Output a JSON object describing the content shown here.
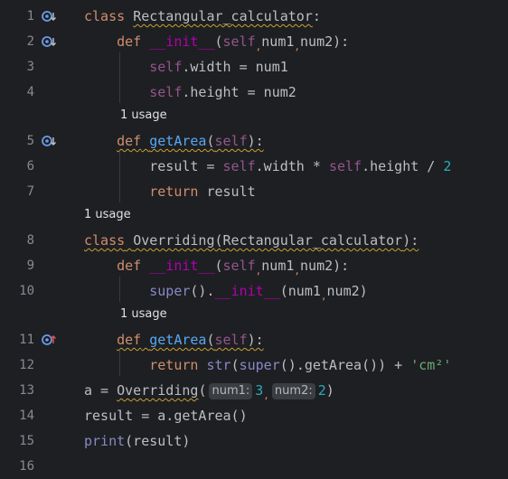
{
  "gutter": {
    "line_numbers": [
      "1",
      "2",
      "3",
      "4",
      "5",
      "6",
      "7",
      "8",
      "9",
      "10",
      "11",
      "12",
      "13",
      "14",
      "15",
      "16"
    ]
  },
  "usages": {
    "before_line5": "1 usage",
    "before_line8": "1 usage",
    "before_line11": "1 usage"
  },
  "code": {
    "l1_kw": "class",
    "l1_name": "Rectangular_calculator",
    "l1_colon": ":",
    "l2_kw": "def",
    "l2_name": "__init__",
    "l2_self": "self",
    "l2_p1": "num1",
    "l2_p2": "num2",
    "l3_self": "self",
    "l3_rest": ".width = num1",
    "l4_self": "self",
    "l4_rest": ".height = num2",
    "l5_kw": "def",
    "l5_name": "getArea",
    "l5_self": "self",
    "l6_var": "result",
    "l6_eq": " = ",
    "l6_self1": "self",
    "l6_mid": ".width * ",
    "l6_self2": "self",
    "l6_mid2": ".height / ",
    "l6_num": "2",
    "l7_kw": "return",
    "l7_rest": " result",
    "l8_kw": "class",
    "l8_name": "Overriding",
    "l8_base": "Rectangular_calculator",
    "l9_kw": "def",
    "l9_name": "__init__",
    "l9_self": "self",
    "l9_p1": "num1",
    "l9_p2": "num2",
    "l10_super": "super",
    "l10_init": "__init__",
    "l10_args": "num1",
    "l10_args2": "num2",
    "l11_kw": "def",
    "l11_name": "getArea",
    "l11_self": "self",
    "l12_kw": "return",
    "l12_str": "str",
    "l12_super": "super",
    "l12_call": ".getArea",
    "l12_plus": " + ",
    "l12_lit": "'cm²'",
    "l13_a": "a = ",
    "l13_cls": "Overriding",
    "l13_hint1": "num1:",
    "l13_v1": "3",
    "l13_hint2": "num2:",
    "l13_v2": "2",
    "l14_text": "result = a.getArea()",
    "l15_print": "print",
    "l15_arg": "(result)"
  },
  "colors": {
    "background": "#1e1f22",
    "keyword": "#cf8e6d",
    "self": "#94558d",
    "dunder": "#b200b2",
    "number": "#2aacb8",
    "string": "#6aab73",
    "builtin": "#8888c6"
  }
}
